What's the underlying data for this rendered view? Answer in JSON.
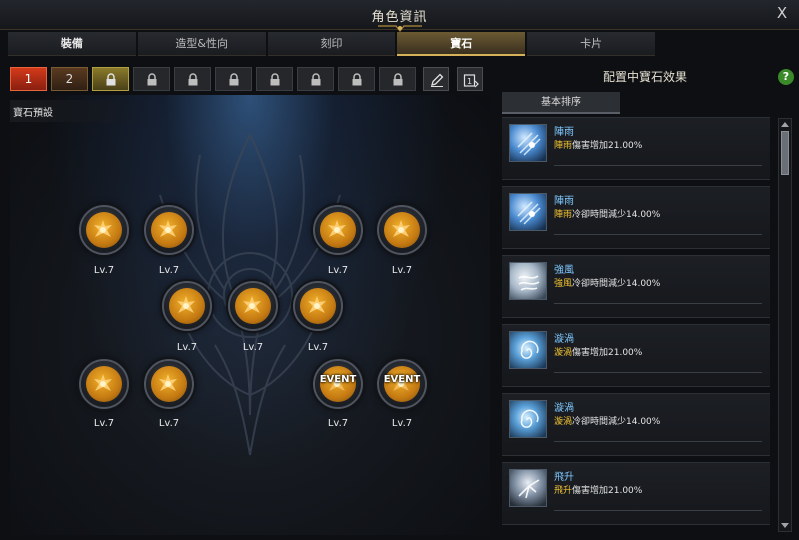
{
  "window": {
    "title": "角色資訊",
    "close_label": "X"
  },
  "tabs": [
    {
      "label": "裝備"
    },
    {
      "label": "造型&性向"
    },
    {
      "label": "刻印"
    },
    {
      "label": "寶石",
      "active": true
    },
    {
      "label": "卡片"
    }
  ],
  "preset_slots": [
    "1",
    "2"
  ],
  "locked_slot_count": 8,
  "tools": [
    "edit-icon",
    "preset-copy-icon"
  ],
  "preset_label": "寶石預設",
  "gems": [
    {
      "level": "Lv.7",
      "event": ""
    },
    {
      "level": "Lv.7",
      "event": ""
    },
    {
      "level": "Lv.7",
      "event": ""
    },
    {
      "level": "Lv.7",
      "event": ""
    },
    {
      "level": "Lv.7",
      "event": ""
    },
    {
      "level": "Lv.7",
      "event": ""
    },
    {
      "level": "Lv.7",
      "event": ""
    },
    {
      "level": "Lv.7",
      "event": ""
    },
    {
      "level": "Lv.7",
      "event": ""
    },
    {
      "level": "Lv.7",
      "event": "EVENT"
    },
    {
      "level": "Lv.7",
      "event": "EVENT"
    }
  ],
  "panel": {
    "title": "配置中寶石效果",
    "help_label": "?",
    "sort_label": "基本排序",
    "effects": [
      {
        "name": "陣雨",
        "skill": "陣雨",
        "text": "傷害增加21.00%",
        "icon": "rain-skill-icon"
      },
      {
        "name": "陣雨",
        "skill": "陣雨",
        "text": "冷卻時間減少14.00%",
        "icon": "rain-skill-icon"
      },
      {
        "name": "強風",
        "skill": "強風",
        "text": "冷卻時間減少14.00%",
        "icon": "wind-skill-icon"
      },
      {
        "name": "漩渦",
        "skill": "漩渦",
        "text": "傷害增加21.00%",
        "icon": "vortex-skill-icon"
      },
      {
        "name": "漩渦",
        "skill": "漩渦",
        "text": "冷卻時間減少14.00%",
        "icon": "vortex-skill-icon"
      },
      {
        "name": "飛升",
        "skill": "飛升",
        "text": "傷害增加21.00%",
        "icon": "soar-skill-icon"
      }
    ]
  },
  "colors": {
    "accent_gold": "#d6b15a",
    "skill_name_blue": "#7ec8ff",
    "skill_highlight": "#f2c432",
    "active_slot_red": "#d33a1a"
  }
}
